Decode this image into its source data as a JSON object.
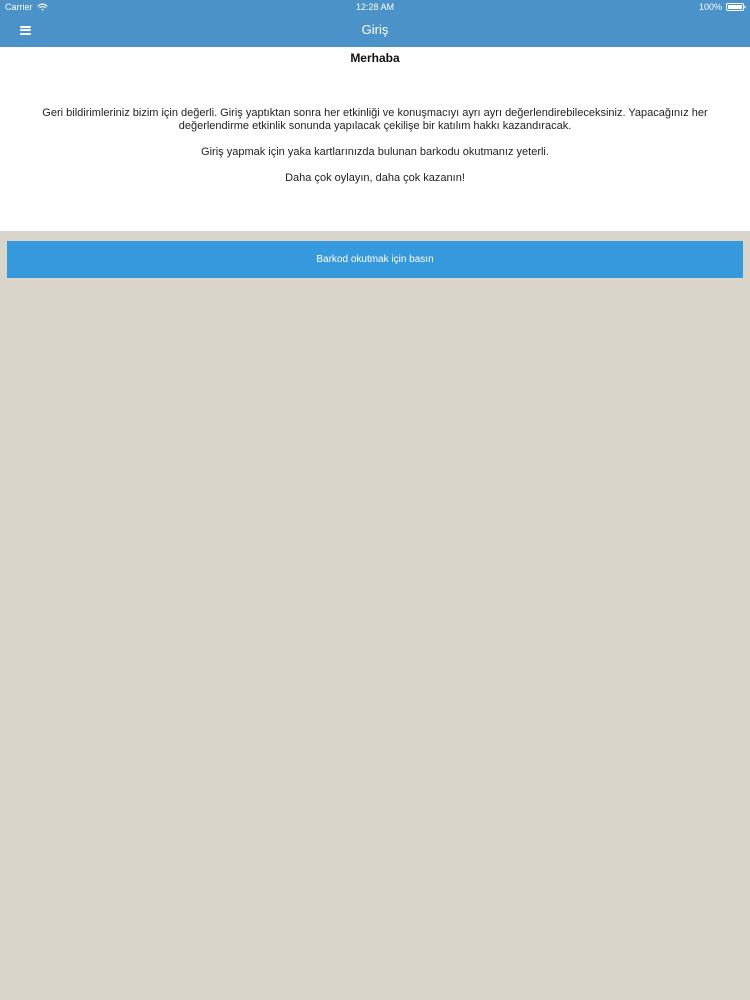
{
  "status_bar": {
    "carrier": "Carrier",
    "time": "12:28 AM",
    "battery": "100%",
    "wifi_icon": "wifi-icon",
    "battery_icon": "battery-icon"
  },
  "navigation": {
    "title": "Giriş",
    "menu_icon": "hamburger-icon"
  },
  "content": {
    "greeting": "Merhaba",
    "paragraphs": [
      "Geri bildirimleriniz bizim için değerli. Giriş yaptıktan sonra her etkinliği ve konuşmacıyı ayrı ayrı değerlendirebileceksiniz. Yapacağınız her değerlendirme etkinlik sonunda yapılacak çekilişe bir katılım hakkı kazandıracak.",
      "Giriş yapmak için yaka kartlarınızda bulunan barkodu okutmanız yeterli.",
      "Daha çok oylayın, daha çok kazanın!"
    ]
  },
  "actions": {
    "scan_label": "Barkod okutmak için basın"
  },
  "colors": {
    "nav_bar": "#4a92c7",
    "scan_button": "#3699dd",
    "background": "#d9d5ca",
    "panel": "#ffffff"
  }
}
